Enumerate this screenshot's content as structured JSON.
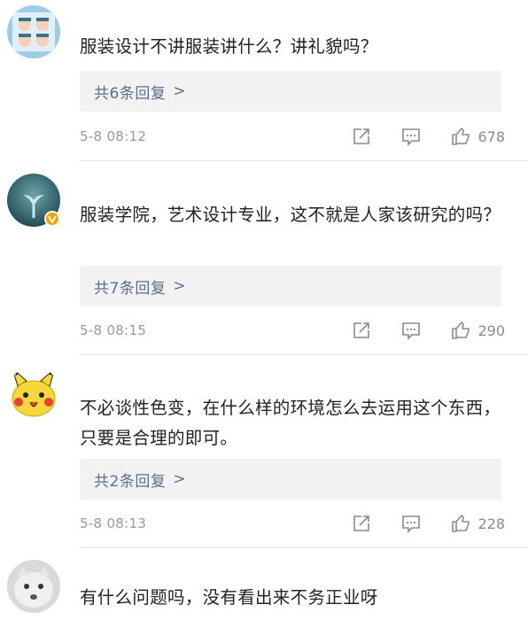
{
  "comments": [
    {
      "text": "服装设计不讲服装讲什么？讲礼貌吗？",
      "replies_label": "共6条回复",
      "chevron": ">",
      "time": "5-8 08:12",
      "likes": "678",
      "avatar": "cartoon-faces-avatar"
    },
    {
      "text": "服装学院，艺术设计专业，这不就是人家该研究的吗？",
      "replies_label": "共7条回复",
      "chevron": ">",
      "time": "5-8 08:15",
      "likes": "290",
      "avatar": "whale-tail-avatar",
      "verified": true
    },
    {
      "text": "不必谈性色变，在什么样的环境怎么去运用这个东西，只要是合理的即可。",
      "replies_label": "共2条回复",
      "chevron": ">",
      "time": "5-8 08:13",
      "likes": "228",
      "avatar": "pikachu-avatar"
    },
    {
      "text": "有什么问题吗，没有看出来不务正业呀",
      "avatar": "cat-face-avatar"
    }
  ],
  "colors": {
    "reply_link": "#5b6e8e",
    "meta_gray": "#9a9a9a",
    "reply_bg": "#f2f2f2",
    "verified_badge": "#f7a000"
  },
  "icons": [
    "share-icon",
    "comment-icon",
    "like-icon"
  ]
}
